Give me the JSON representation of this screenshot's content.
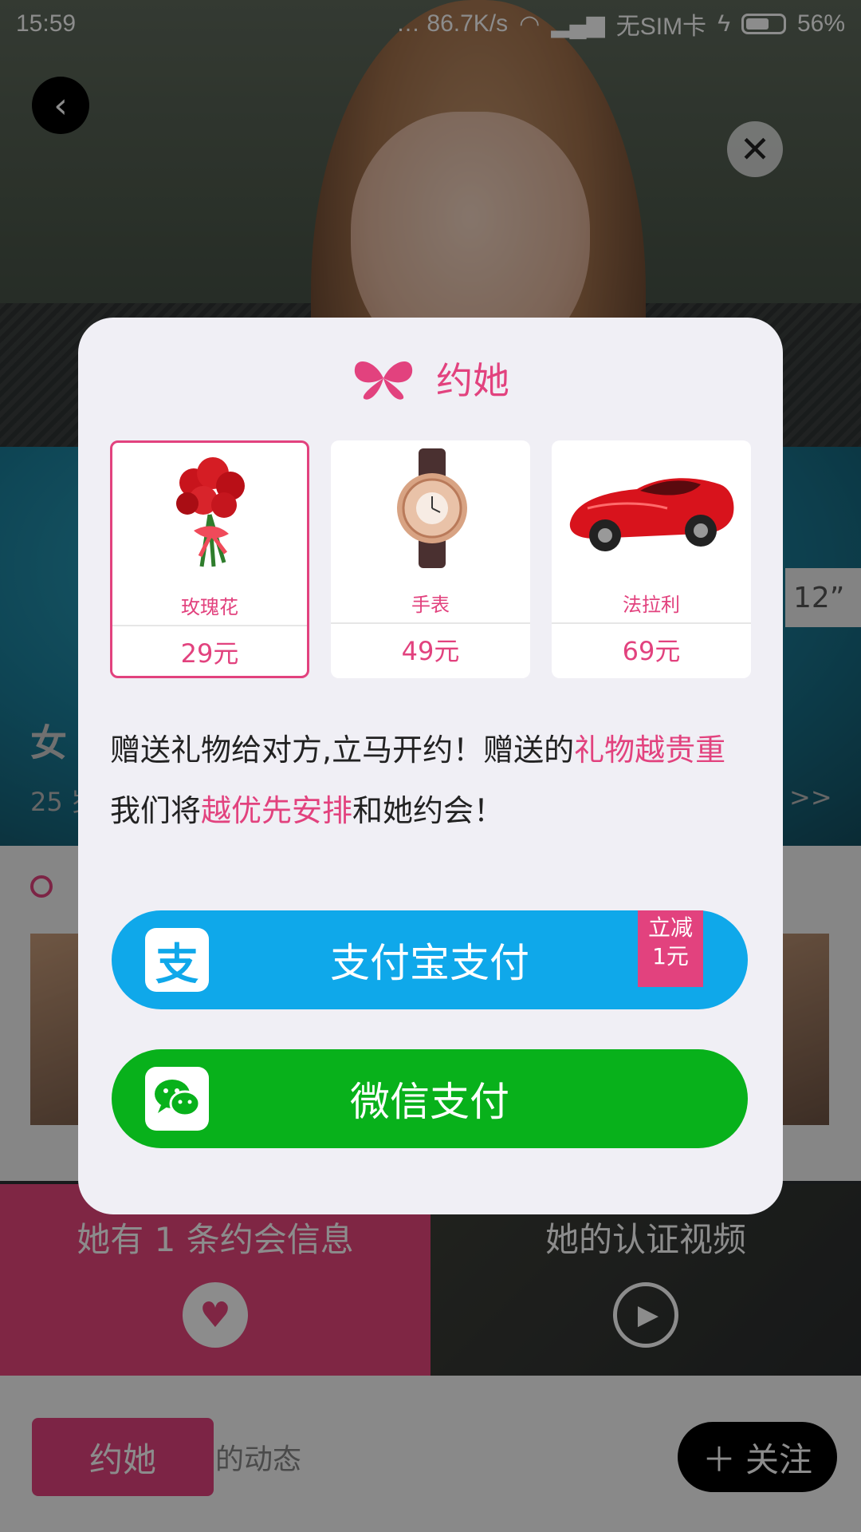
{
  "status_bar": {
    "time": "15:59",
    "speed": "… 86.7K/s",
    "carrier": "无SIM卡",
    "battery_percent": "56%"
  },
  "background": {
    "tag": "12”",
    "name_partial": "女",
    "age_partial": "25 岁",
    "more": ">>",
    "tile_dating": "她有 1 条约会信息",
    "tile_video": "她的认证视频",
    "yue_button": "约她",
    "feed_partial": "的动态",
    "follow_button": "关注"
  },
  "dialog": {
    "title": "约她",
    "gifts": [
      {
        "name": "玫瑰花",
        "price": "29元",
        "selected": true,
        "icon": "rose-bouquet"
      },
      {
        "name": "手表",
        "price": "49元",
        "selected": false,
        "icon": "watch"
      },
      {
        "name": "法拉利",
        "price": "69元",
        "selected": false,
        "icon": "red-sports-car"
      }
    ],
    "desc_1": "赠送礼物给对方,立马开约！赠送的",
    "desc_2": "礼物越贵重",
    "desc_3": "我们将",
    "desc_4": "越优先安排",
    "desc_5": "和她约会！",
    "alipay_label": "支付宝支付",
    "alipay_badge_line1": "立减",
    "alipay_badge_line2": "1元",
    "alipay_glyph": "支",
    "wechat_label": "微信支付"
  },
  "colors": {
    "accent": "#e2427e",
    "alipay": "#0fa8ea",
    "wechat": "#08b11b"
  }
}
